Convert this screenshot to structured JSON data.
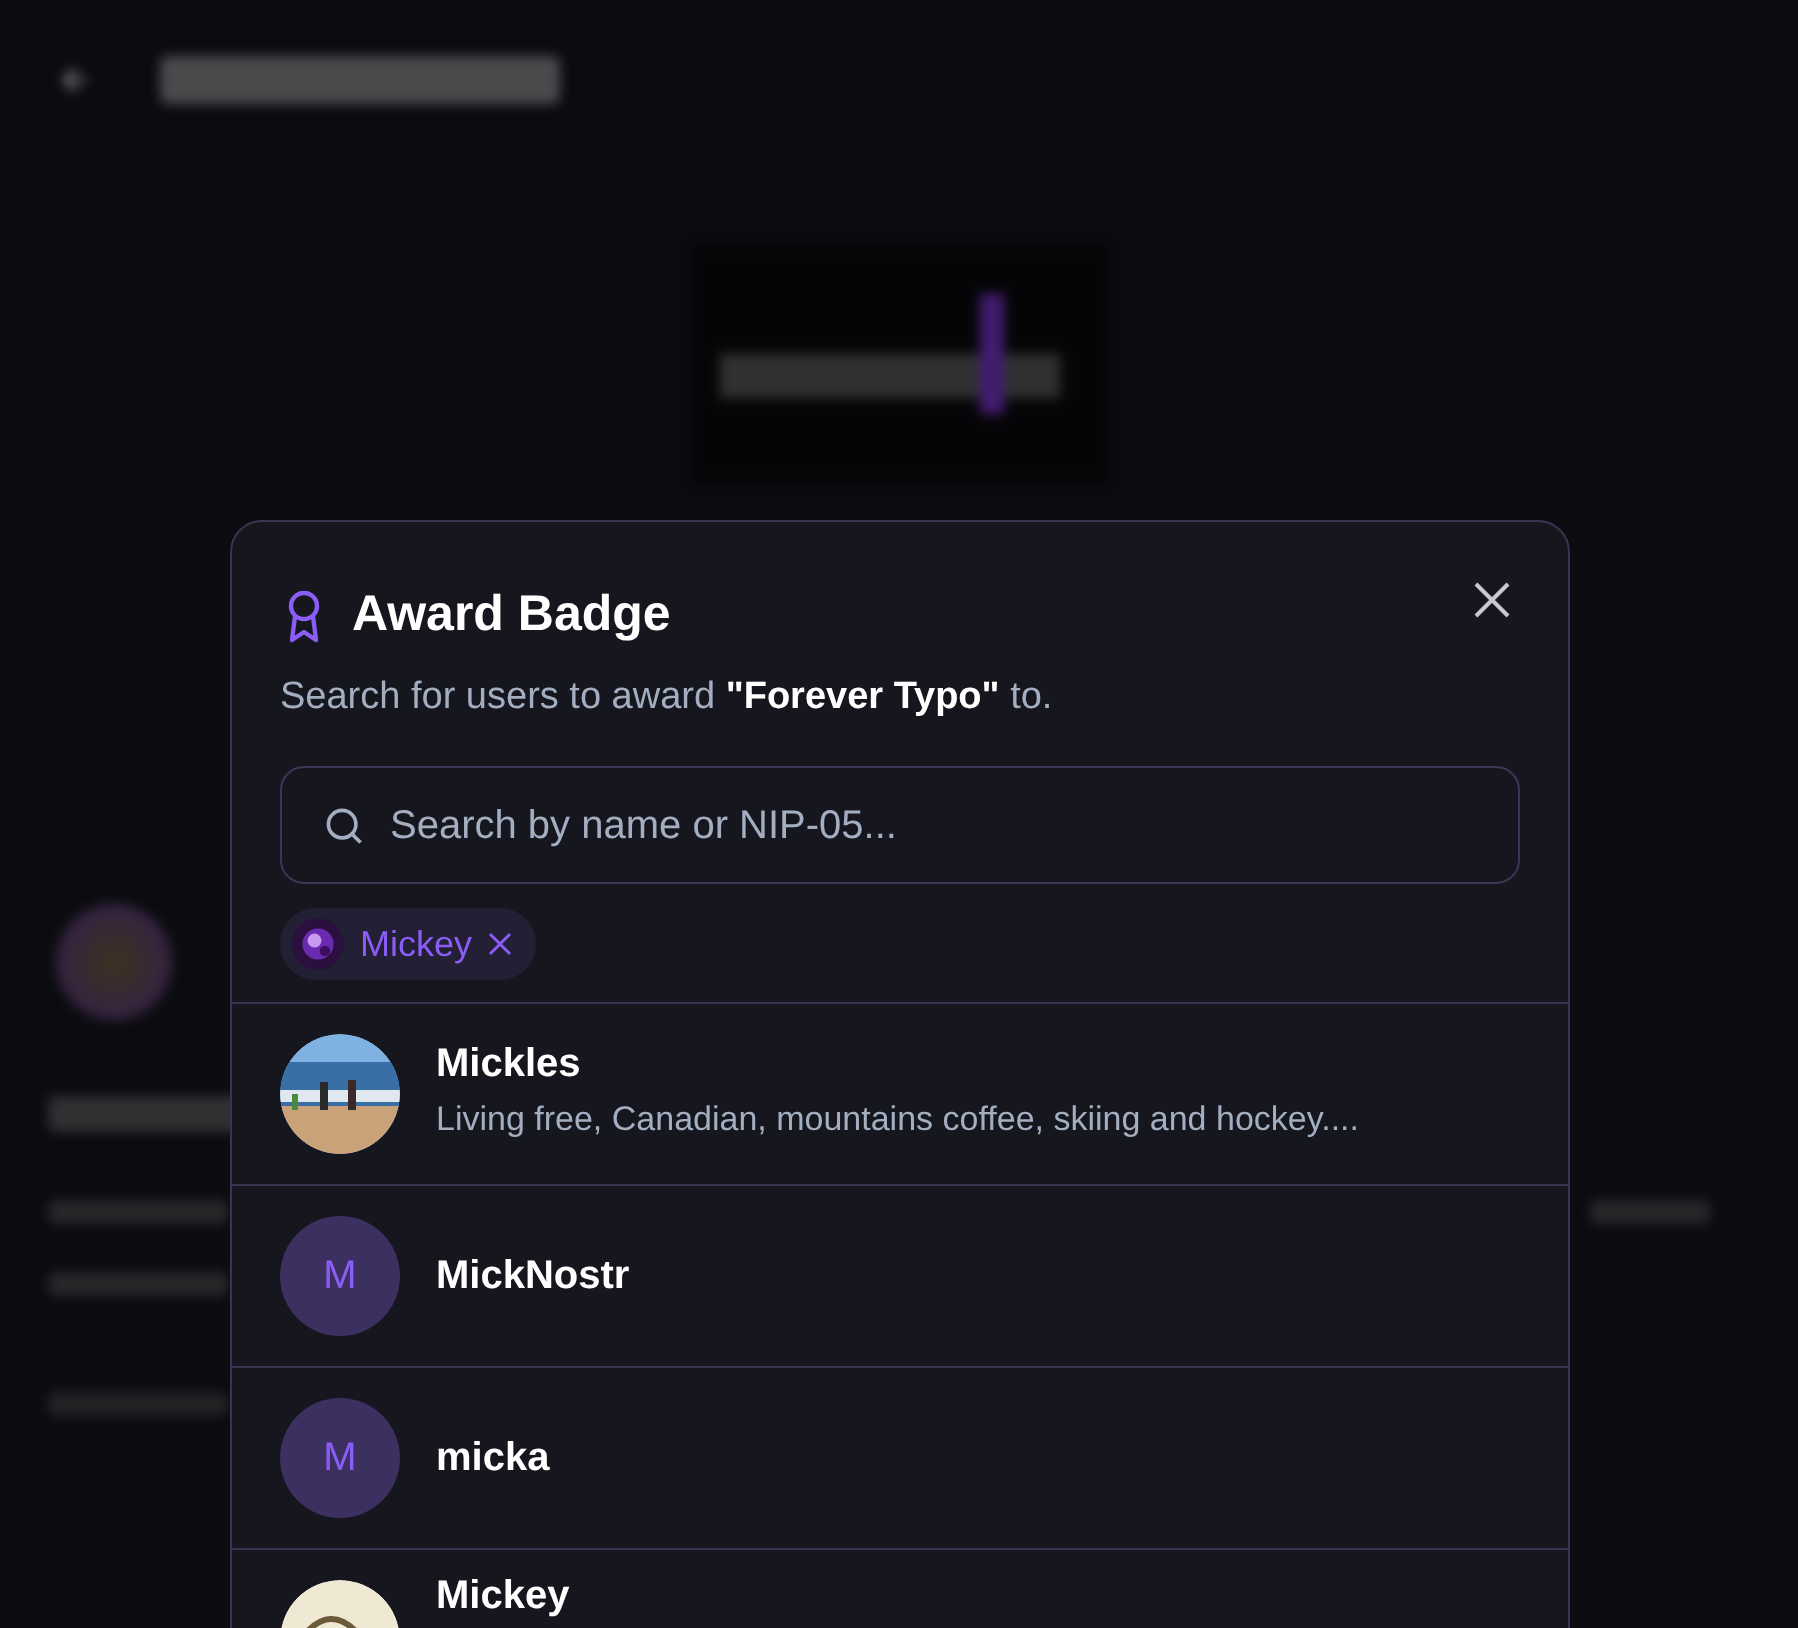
{
  "dialog": {
    "title": "Award Badge",
    "subtitle": "Search for users to award **\"Forever Typo\"** to.",
    "search": {
      "placeholder": "Search by name or NIP-05..."
    },
    "selected_users": [
      {
        "name": "Mickey"
      }
    ],
    "results": [
      {
        "name": "Mickles",
        "about": "Living free, Canadian, mountains coffee, skiing and hockey...."
      },
      {
        "name": "MickNostr",
        "avatar": {
          "kind": "initial",
          "text": "M"
        }
      },
      {
        "name": "micka",
        "avatar": {
          "kind": "initial",
          "text": "M"
        }
      },
      {
        "name": "Mickey"
      }
    ]
  }
}
